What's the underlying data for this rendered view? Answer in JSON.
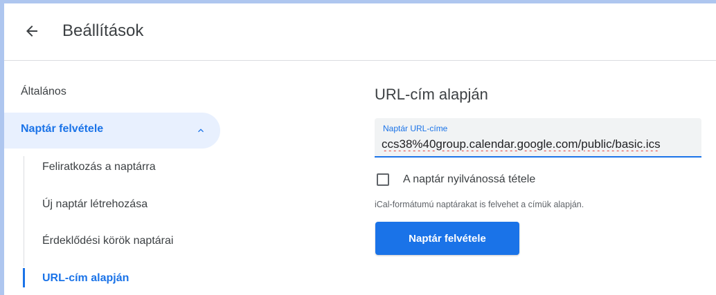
{
  "header": {
    "title": "Beállítások",
    "back_icon": "arrow-back-icon"
  },
  "sidebar": {
    "top_item": "Általános",
    "group": {
      "label": "Naptár felvétele",
      "icon": "chevron-up-icon"
    },
    "sub_items": [
      {
        "label": "Feliratkozás a naptárra"
      },
      {
        "label": "Új naptár létrehozása"
      },
      {
        "label": "Érdeklődési körök naptárai"
      },
      {
        "label": "URL-cím alapján",
        "active": true
      }
    ]
  },
  "main": {
    "section_title": "URL-cím alapján",
    "url_field": {
      "label": "Naptár URL-címe",
      "value": "ccs38%40group.calendar.google.com/public/basic.ics"
    },
    "public_checkbox": {
      "label": "A naptár nyilvánossá tétele",
      "checked": false
    },
    "helper_text": "iCal-formátumú naptárakat is felvehet a címük alapján.",
    "submit_button": "Naptár felvétele"
  },
  "colors": {
    "accent": "#1a73e8",
    "nav_selected_bg": "#e8f0fe",
    "field_bg": "#f1f3f4"
  }
}
